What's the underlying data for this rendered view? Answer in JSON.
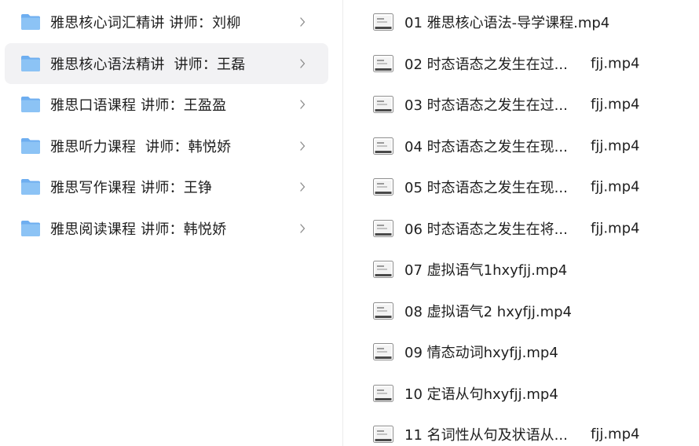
{
  "colors": {
    "folder": "#8cc3f5",
    "folder_tab": "#6eaef0",
    "selected_bg": "#f2f2f4",
    "text": "#1f1f1f",
    "chevron": "#8a8a8a"
  },
  "folders": [
    {
      "label": "雅思核心词汇精讲 讲师：刘柳",
      "icon": "folder-icon"
    },
    {
      "label": "雅思核心语法精讲  讲师：王磊",
      "icon": "folder-icon",
      "selected": true
    },
    {
      "label": "雅思口语课程 讲师：王盈盈",
      "icon": "folder-icon"
    },
    {
      "label": "雅思听力课程  讲师：韩悦娇",
      "icon": "folder-icon"
    },
    {
      "label": "雅思写作课程 讲师：王铮",
      "icon": "folder-icon"
    },
    {
      "label": "雅思阅读课程 讲师：韩悦娇",
      "icon": "folder-icon"
    }
  ],
  "files": [
    {
      "name": "01 雅思核心语法-导学课程.mp4",
      "ext": ""
    },
    {
      "name": "02 时态语态之发生在过...",
      "ext": "fjj.mp4"
    },
    {
      "name": "03 时态语态之发生在过...",
      "ext": "fjj.mp4"
    },
    {
      "name": "04 时态语态之发生在现...",
      "ext": "fjj.mp4"
    },
    {
      "name": "05 时态语态之发生在现...",
      "ext": "fjj.mp4"
    },
    {
      "name": "06 时态语态之发生在将...",
      "ext": "fjj.mp4"
    },
    {
      "name": "07 虚拟语气1hxyfjj.mp4",
      "ext": ""
    },
    {
      "name": "08 虚拟语气2 hxyfjj.mp4",
      "ext": ""
    },
    {
      "name": "09 情态动词hxyfjj.mp4",
      "ext": ""
    },
    {
      "name": "10 定语从句hxyfjj.mp4",
      "ext": ""
    },
    {
      "name": "11 名词性从句及状语从...",
      "ext": "fjj.mp4"
    }
  ]
}
